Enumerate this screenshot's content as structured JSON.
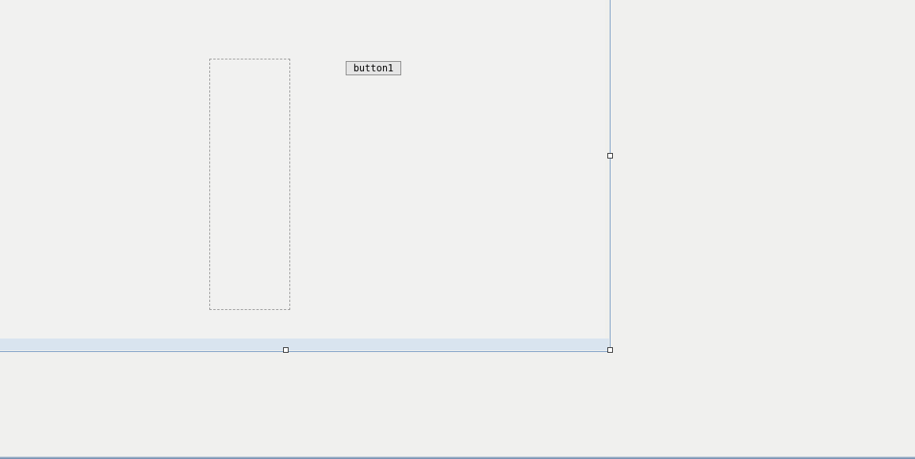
{
  "form": {
    "button1_label": "button1"
  }
}
